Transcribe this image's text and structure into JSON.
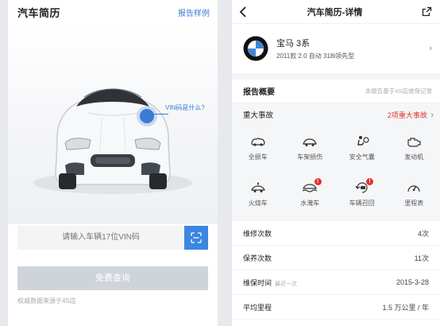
{
  "left": {
    "logo": "汽车简历",
    "sample_link": "报告样例",
    "vin_tip": "VIN码是什么?",
    "vin_placeholder": "请输入车辆17位VIN码",
    "query_button": "免费查询",
    "source_note": "权威数据来源于4S店"
  },
  "right": {
    "title": "汽车简历-详情",
    "car": {
      "name": "宝马 3系",
      "spec": "2011款 2.0 自动 318i领先型",
      "brand_icon": "bmw-logo"
    },
    "summary": {
      "title": "报告概要",
      "note": "本报告基于4S店维保记录"
    },
    "major": {
      "label": "重大事故",
      "count": "2项重大事故"
    },
    "checks": [
      {
        "label": "全损车",
        "icon": "total-loss-icon",
        "alert": false
      },
      {
        "label": "车架损伤",
        "icon": "frame-damage-icon",
        "alert": false
      },
      {
        "label": "安全气囊",
        "icon": "airbag-icon",
        "alert": false
      },
      {
        "label": "发动机",
        "icon": "engine-icon",
        "alert": false
      },
      {
        "label": "火烧车",
        "icon": "fire-car-icon",
        "alert": false
      },
      {
        "label": "水淹车",
        "icon": "flood-car-icon",
        "alert": true
      },
      {
        "label": "车辆召回",
        "icon": "recall-icon",
        "alert": true
      },
      {
        "label": "里程表",
        "icon": "odometer-icon",
        "alert": false
      }
    ],
    "alert_mark": "!",
    "stats": [
      {
        "label": "维修次数",
        "sub": "",
        "value": "4次"
      },
      {
        "label": "保养次数",
        "sub": "",
        "value": "11次"
      },
      {
        "label": "维保时间",
        "sub": "最近一次",
        "value": "2015-3-28"
      },
      {
        "label": "平均里程",
        "sub": "",
        "value": "1.5 万公里 / 年"
      }
    ]
  },
  "colors": {
    "accent": "#3a86e0",
    "alert": "#e0352b"
  }
}
